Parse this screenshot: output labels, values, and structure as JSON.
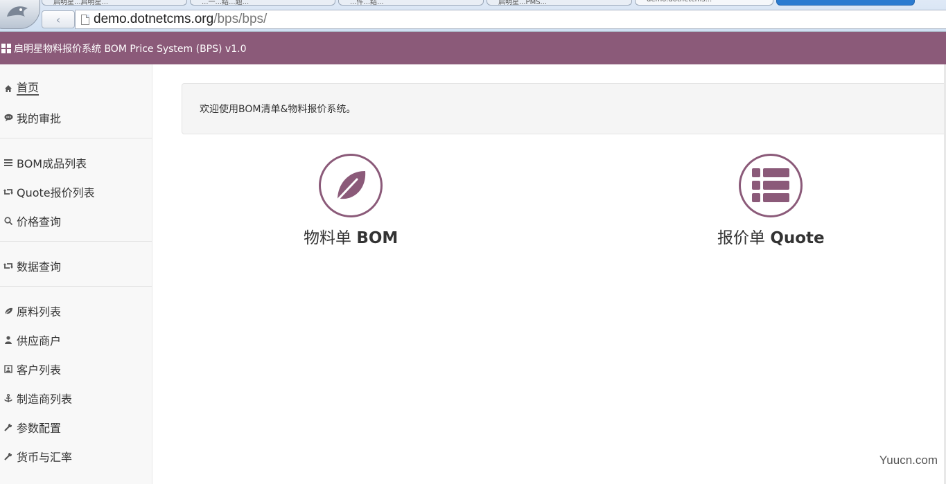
{
  "browser": {
    "tabs": [
      {
        "label": "启明星...启明星..."
      },
      {
        "label": "...一...结...题..."
      },
      {
        "label": "...件...结..."
      },
      {
        "label": "启明星...PMS..."
      },
      {
        "label": "demo.dotnetcms..."
      },
      {
        "label": ""
      }
    ],
    "url_host": "demo.dotnetcms.org",
    "url_path": "/bps/bps/",
    "back_symbol": "‹"
  },
  "header": {
    "brand": "启明星物料报价系统 BOM Price System   (BPS) v1.0"
  },
  "sidebar": {
    "groups": [
      {
        "items": [
          {
            "label": "首页",
            "icon": "home-icon"
          },
          {
            "label": "我的审批",
            "icon": "comment-icon"
          }
        ]
      },
      {
        "items": [
          {
            "label": "BOM成品列表",
            "icon": "list-icon"
          },
          {
            "label": "Quote报价列表",
            "icon": "retweet-icon"
          },
          {
            "label": "价格查询",
            "icon": "search-icon"
          }
        ]
      },
      {
        "items": [
          {
            "label": "数据查询",
            "icon": "retweet-icon"
          }
        ]
      },
      {
        "items": [
          {
            "label": "原料列表",
            "icon": "leaf-icon"
          },
          {
            "label": "供应商户",
            "icon": "user-icon"
          },
          {
            "label": "客户列表",
            "icon": "contact-card-icon"
          },
          {
            "label": "制造商列表",
            "icon": "anchor-icon"
          },
          {
            "label": "参数配置",
            "icon": "wrench-icon"
          },
          {
            "label": "货币与汇率",
            "icon": "wrench-icon"
          }
        ]
      }
    ]
  },
  "main": {
    "welcome": "欢迎使用BOM清单&物料报价系统。",
    "tiles": [
      {
        "label_cn": "物料单 ",
        "label_en": "BOM",
        "icon": "leaf-icon"
      },
      {
        "label_cn": "报价单 ",
        "label_en": "Quote",
        "icon": "th-list-icon"
      }
    ]
  },
  "watermark": "Yuucn.com",
  "colors": {
    "brand": "#8b5a79",
    "sidebar_bg": "#f8f8f8",
    "welcome_bg": "#f5f5f5"
  }
}
